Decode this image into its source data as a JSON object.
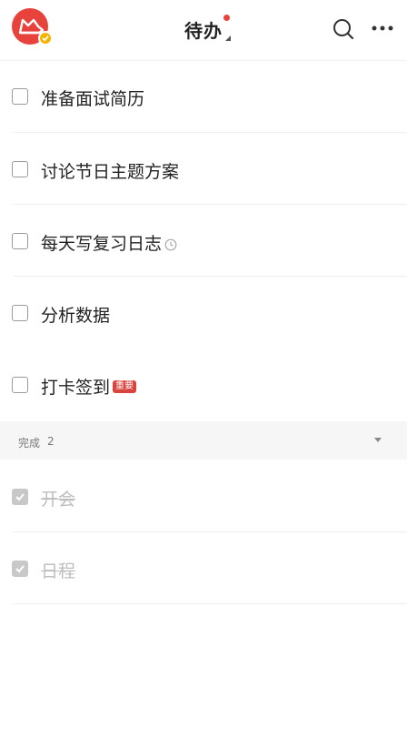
{
  "header": {
    "title": "待办"
  },
  "tasks": [
    {
      "text": "准备面试简历",
      "done": false
    },
    {
      "text": "讨论节日主题方案",
      "done": false
    },
    {
      "text": "每天写复习日志",
      "done": false,
      "icon": "clock-icon"
    },
    {
      "text": "分析数据",
      "done": false
    },
    {
      "text": "打卡签到",
      "done": false,
      "tag": "重要"
    }
  ],
  "completed_section": {
    "label": "完成",
    "count": "2"
  },
  "completed_tasks": [
    {
      "text": "开会",
      "done": true
    },
    {
      "text": "日程",
      "done": true
    }
  ],
  "colors": {
    "accent": "#e8423c",
    "tag": "#d9433d",
    "badge": "#f4b400"
  }
}
